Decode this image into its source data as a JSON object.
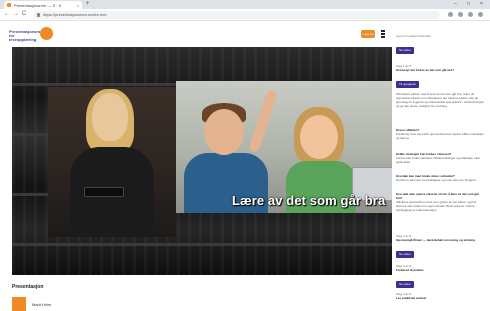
{
  "browser": {
    "tab_title": "Presentasjonsrom — S · K",
    "new_tab": "+",
    "url": "https://presentasjonsrom.no/les-mer",
    "minimize": "–",
    "maximize": "□",
    "close": "×",
    "back": "←",
    "forward": "→",
    "reload": "C"
  },
  "header": {
    "logo_text": "Presentasjonsrom for leseopplæring",
    "cta_label": "Logg inn"
  },
  "video": {
    "caption": "Lære av det som går bra"
  },
  "below": {
    "title": "Presentasjon",
    "author": "Marit Holm"
  },
  "sidebar": {
    "intro_1": "",
    "intro_2": "Les om hvordan du bruker",
    "btn_1": "Se video",
    "s2_small": "Steg 1 av 6",
    "s2_title": "Hva betyr det å lære av det som går bra?",
    "btn_2": "Til oppgaven",
    "s3_text": "Når lærere jobber med å lære av det som går bra, retter de oppmerksomheten mot situasjoner der elevene lykkes. Det gir grunnlag for å gjenta og videreutvikle god praksis i undervisningen og gir alle elever mulighet for mestring.",
    "s4_title": "Hva er effekten?",
    "s4_text": "Forskning viser at positiv oppmerksomhet styrker både motivasjon og læring.",
    "s5_title": "Hvilke strategier kan brukes i klassen?",
    "s5_text": "Lærere kan bruke samtaler, tilbakemeldinger og refleksjon etter gode økter.",
    "s6_title": "Hvordan kan man bruke video i arbeidet?",
    "s6_text": "Se filmen sammen med kollegaer og noter det som fungerte.",
    "s7_title": "Hva skal man spørre elevene om for å lære av det som går bra?",
    "s7_text": "Still åpne spørsmål om hva som gjorde at noe lyktes, og hva elevene selv tenker om egen innsats. Bruk svarene i videre planlegging av undervisningen.",
    "s8_small": "Steg 2 av 6",
    "s8_title": "Gjennomgå filmen — lærerdebatt om lesing og skriving",
    "btn_8": "Se video",
    "s9_small": "Steg 3 av 6",
    "s9_title": "Forbered til praksis",
    "btn_9": "Se video",
    "s10_small": "Steg 4 av 6",
    "s10_title": "Les praktiske øvelser"
  }
}
